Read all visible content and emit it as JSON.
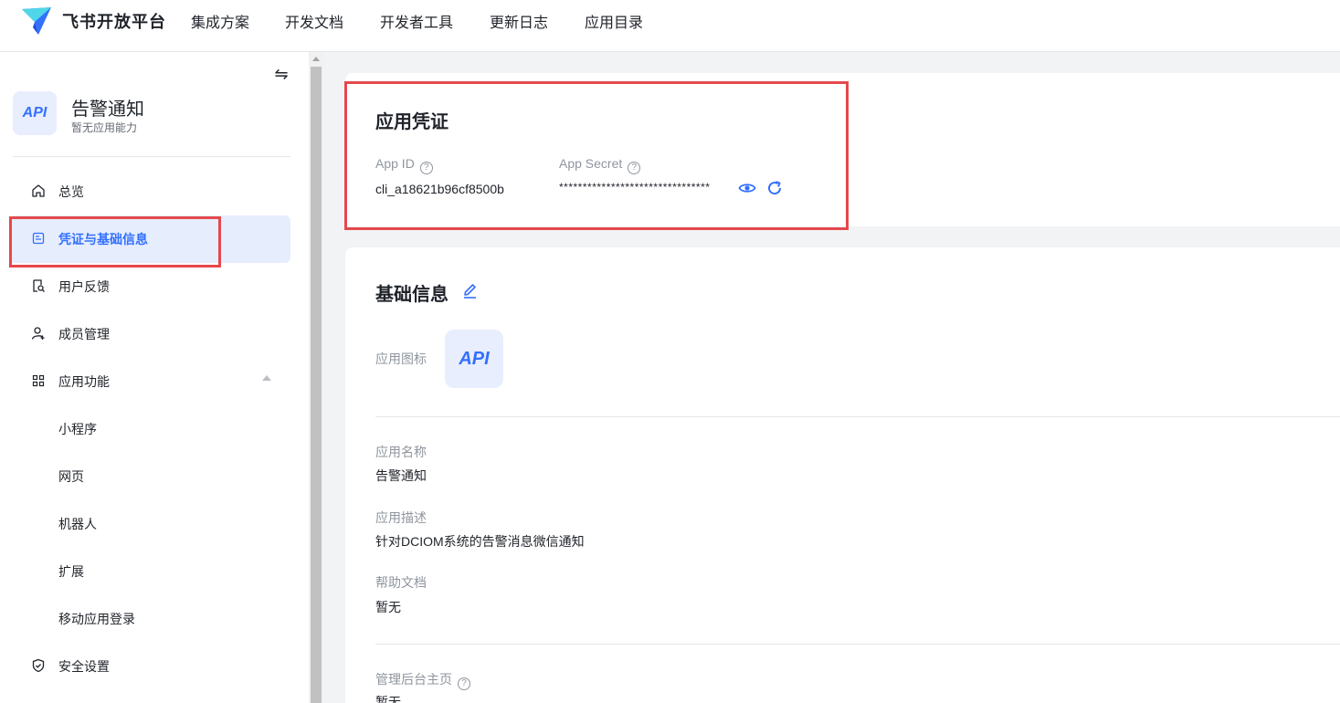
{
  "topnav": {
    "brand": "飞书开放平台",
    "items": [
      "集成方案",
      "开发文档",
      "开发者工具",
      "更新日志",
      "应用目录"
    ]
  },
  "sidebar": {
    "app": {
      "avatar_text": "API",
      "name": "告警通知",
      "subtitle": "暂无应用能力"
    },
    "items": [
      {
        "label": "总览",
        "icon": "home-icon"
      },
      {
        "label": "凭证与基础信息",
        "icon": "credential-icon",
        "active": true
      },
      {
        "label": "用户反馈",
        "icon": "feedback-icon"
      },
      {
        "label": "成员管理",
        "icon": "user-add-icon"
      },
      {
        "label": "应用功能",
        "icon": "grid-icon"
      },
      {
        "label": "小程序"
      },
      {
        "label": "网页"
      },
      {
        "label": "机器人"
      },
      {
        "label": "扩展"
      },
      {
        "label": "移动应用登录"
      },
      {
        "label": "安全设置",
        "icon": "shield-icon"
      }
    ]
  },
  "credentials": {
    "title": "应用凭证",
    "app_id_label": "App ID",
    "app_id_value": "cli_a18621b96cf8500b",
    "app_secret_label": "App Secret",
    "app_secret_value": "********************************"
  },
  "basic_info": {
    "title": "基础信息",
    "icon_label": "应用图标",
    "icon_text": "API",
    "name_label": "应用名称",
    "name_value": "告警通知",
    "desc_label": "应用描述",
    "desc_value": "针对DCIOM系统的告警消息微信通知",
    "help_label": "帮助文档",
    "help_value": "暂无",
    "admin_label": "管理后台主页",
    "admin_value": "暂无"
  },
  "colors": {
    "accent": "#3370ff",
    "highlight_box": "#e5484d",
    "active_bg": "#e6edfd"
  }
}
